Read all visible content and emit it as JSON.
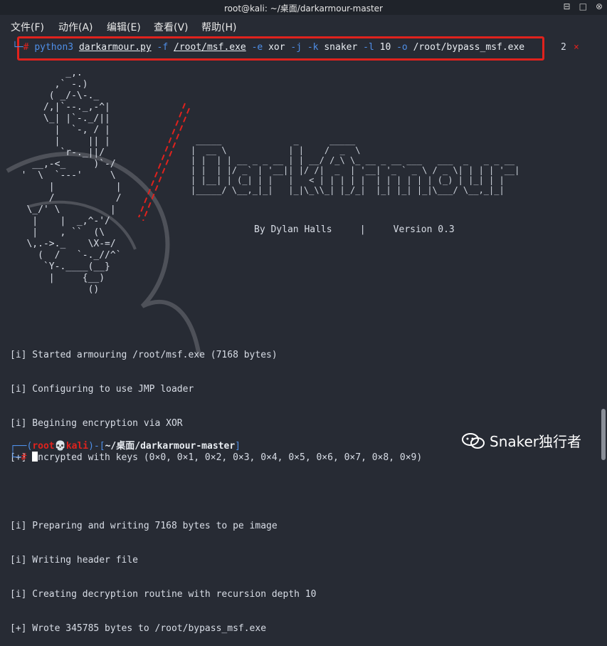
{
  "window": {
    "title": "root@kali: ~/桌面/darkarmour-master",
    "buttons": [
      "⊟",
      "□",
      "⊗"
    ]
  },
  "menu": [
    "文件(F)",
    "动作(A)",
    "编辑(E)",
    "查看(V)",
    "帮助(H)"
  ],
  "command": {
    "prompt_corner": "└─",
    "hash": "#",
    "python": "python3",
    "script": "darkarmour.py",
    "flag_f": "-f",
    "file": "/root/msf.exe",
    "flag_e": "-e",
    "enc": "xor",
    "flag_j": "-j",
    "flag_k": "-k",
    "key": "snaker",
    "flag_l": "-l",
    "loops": "10",
    "flag_o": "-o",
    "outfile": "/root/bypass_msf.exe",
    "tab_number": "2",
    "tab_close": "×"
  },
  "ascii_art": "          _,.\n        ,` -.)\n       ( _/-\\-._\n      /,|`--._,-^|\n      \\_| |`-._/||\n        |  `-, / |\n        |     || |\n         `r-._||/\n    __,-<_     )`-/\n  '  \\  `---'     \\\n       |           |\n       /           /\n   \\_/' \\         |\n    |    |  _,^-'/\n    |    , ``  (\\\n   \\,.->._    \\X-=/\n     (  /   `-._//^`\n      `Y-.____(__}\n       |     {__)\n              ()",
  "logo_art": " _____              _      _____\n|  __ \\            | |    /  _  \\\n| |  | | __ _ _ __ | | __/ /_\\ \\_ __ _ __ ___   ___  _   _ _ __\n| |  | |/ _` | '__|| |/ /|  _  | '__| '_ ` _ \\ / _ \\| | | | '__|\n| |__| | (_| | |   |   < | | | | |  | | | | | | (_) | |_| | |\n|_____/ \\__,_|_|   |_|\\_\\\\_| |_/_|  |_| |_| |_|\\___/ \\__,_|_|",
  "byline": "By Dylan Halls     |     Version 0.3",
  "output_lines": [
    "[i] Started armouring /root/msf.exe (7168 bytes)",
    "[i] Configuring to use JMP loader",
    "[i] Begining encryption via XOR",
    "[+] Encrypted with keys (0×0, 0×1, 0×2, 0×3, 0×4, 0×5, 0×6, 0×7, 0×8, 0×9)",
    "",
    "[i] Preparing and writing 7168 bytes to pe image",
    "[i] Writing header file",
    "[i] Creating decryption routine with recursion depth 10",
    "[+] Wrote 345785 bytes to /root/bypass_msf.exe"
  ],
  "prompt": {
    "open": "┌──(",
    "user": "root",
    "skull": "💀",
    "host": "kali",
    "mid": ")-[",
    "path": "~/桌面/darkarmour-master",
    "close": "]",
    "corner": "└─",
    "hash": "#"
  },
  "watermark": "Snaker独行者",
  "colors": {
    "accent_red": "#e0221d",
    "prompt_blue": "#4f8fe8",
    "background": "#272b34"
  }
}
